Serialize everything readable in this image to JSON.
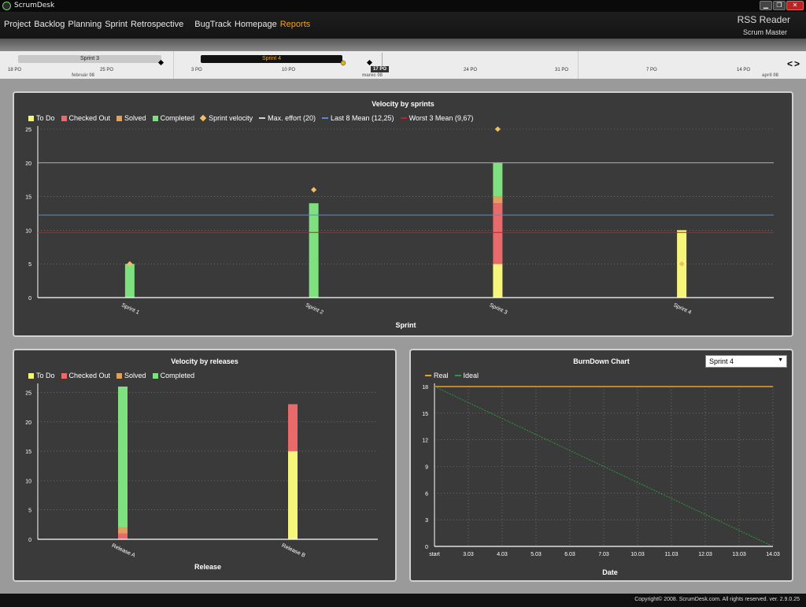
{
  "window": {
    "title": "ScrumDesk",
    "buttons": [
      "▁",
      "❐",
      "✕"
    ]
  },
  "menu": {
    "items": [
      "Project",
      "Backlog",
      "Planning",
      "Sprint",
      "Retrospective",
      "BugTrack",
      "Homepage",
      "Reports"
    ],
    "active": "Reports"
  },
  "header": {
    "rss": "RSS Reader",
    "role": "Scrum Master"
  },
  "timeline": {
    "sprints": [
      "Sprint 3",
      "Sprint 4"
    ],
    "ticks": [
      "18 PO",
      "25 PO",
      "3 PO",
      "10 PO",
      "24 PO",
      "31 PO",
      "7 PO",
      "14 PO"
    ],
    "months": [
      "február 08",
      "marec 08",
      "apríl 08"
    ],
    "today": "17 PO",
    "nav": "<>"
  },
  "colors": {
    "todo": "#f5f57a",
    "checked": "#e86a6a",
    "solved": "#e0a060",
    "completed": "#7ee07e",
    "velocity": "#f0c060",
    "max": "#b0b0b0",
    "mean8": "#5a8ad0",
    "worst3": "#c02020",
    "real": "#f0a020",
    "ideal": "#2a9a3a"
  },
  "legend_sprints": [
    "To Do",
    "Checked Out",
    "Solved",
    "Completed",
    "Sprint velocity",
    "Max. effort (20)",
    "Last 8 Mean (12,25)",
    "Worst 3 Mean (9,67)"
  ],
  "legend_releases": [
    "To Do",
    "Checked Out",
    "Solved",
    "Completed"
  ],
  "legend_burndown": [
    "Real",
    "Ideal"
  ],
  "burndown_select": "Sprint 4",
  "footer": "Copyright© 2008. ScrumDesk.com. All rights reserved. ver. 2.9.0.25",
  "chart_data": [
    {
      "type": "bar",
      "title": "Velocity by sprints",
      "xlabel": "Sprint",
      "ylabel": "",
      "ylim": [
        0,
        25
      ],
      "yticks": [
        0,
        5,
        10,
        15,
        20,
        25
      ],
      "categories": [
        "Sprint 1",
        "Sprint 2",
        "Sprint 3",
        "Sprint 4"
      ],
      "series": [
        {
          "name": "To Do",
          "values": [
            0,
            0,
            5,
            10
          ]
        },
        {
          "name": "Checked Out",
          "values": [
            0,
            0,
            9,
            0
          ]
        },
        {
          "name": "Solved",
          "values": [
            0,
            0,
            1,
            0
          ]
        },
        {
          "name": "Completed",
          "values": [
            5,
            14,
            5,
            0
          ]
        }
      ],
      "velocity": [
        5,
        16,
        25,
        5
      ],
      "lines": [
        {
          "name": "Max. effort (20)",
          "value": 20
        },
        {
          "name": "Last 8 Mean (12,25)",
          "value": 12.25
        },
        {
          "name": "Worst 3 Mean (9,67)",
          "value": 9.67
        }
      ]
    },
    {
      "type": "bar",
      "title": "Velocity by releases",
      "xlabel": "Release",
      "ylabel": "",
      "ylim": [
        0,
        26
      ],
      "yticks": [
        0,
        5,
        10,
        15,
        20,
        25
      ],
      "categories": [
        "Release A",
        "Release B"
      ],
      "series": [
        {
          "name": "To Do",
          "values": [
            0,
            15
          ]
        },
        {
          "name": "Checked Out",
          "values": [
            1,
            8
          ]
        },
        {
          "name": "Solved",
          "values": [
            1,
            0
          ]
        },
        {
          "name": "Completed",
          "values": [
            24,
            0
          ]
        }
      ]
    },
    {
      "type": "line",
      "title": "BurnDown Chart",
      "xlabel": "Date",
      "ylabel": "",
      "ylim": [
        0,
        18
      ],
      "yticks": [
        0,
        3,
        6,
        9,
        12,
        15,
        18
      ],
      "x": [
        "start",
        "3.03",
        "4.03",
        "5.03",
        "6.03",
        "7.03",
        "10.03",
        "11.03",
        "12.03",
        "13.03",
        "14.03"
      ],
      "series": [
        {
          "name": "Real",
          "values": [
            18,
            18,
            18,
            18,
            18,
            18,
            18,
            18,
            18,
            18,
            18
          ]
        },
        {
          "name": "Ideal",
          "values": [
            18,
            16.2,
            14.4,
            12.6,
            10.8,
            9,
            7.2,
            5.4,
            3.6,
            1.8,
            0
          ]
        }
      ]
    }
  ]
}
